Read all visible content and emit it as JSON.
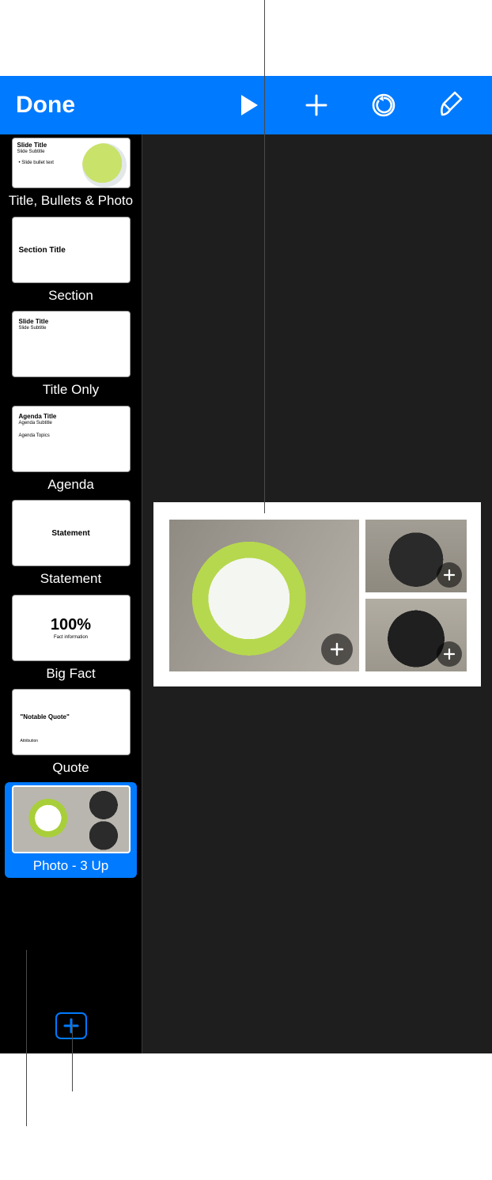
{
  "toolbar": {
    "done_label": "Done"
  },
  "layouts": [
    {
      "label": "Title, Bullets & Photo",
      "kind": "title_bullets_photo",
      "lines": {
        "title": "Slide Title",
        "subtitle": "Slide Subtitle",
        "bullet": "Slide bullet text"
      }
    },
    {
      "label": "Section",
      "kind": "section",
      "lines": {
        "title": "Section Title"
      }
    },
    {
      "label": "Title Only",
      "kind": "title_only",
      "lines": {
        "title": "Slide Title",
        "subtitle": "Slide Subtitle"
      }
    },
    {
      "label": "Agenda",
      "kind": "agenda",
      "lines": {
        "title": "Agenda Title",
        "subtitle": "Agenda Subtitle",
        "body": "Agenda Topics"
      }
    },
    {
      "label": "Statement",
      "kind": "statement",
      "lines": {
        "center": "Statement"
      }
    },
    {
      "label": "Big Fact",
      "kind": "big_fact",
      "lines": {
        "big": "100%",
        "small": "Fact information"
      }
    },
    {
      "label": "Quote",
      "kind": "quote",
      "lines": {
        "quote": "\"Notable Quote\"",
        "attribution": "Attribution"
      }
    },
    {
      "label": "Photo - 3 Up",
      "kind": "photo_3up"
    }
  ],
  "selected_layout_index": 7,
  "slide": {
    "placeholders": 3
  }
}
